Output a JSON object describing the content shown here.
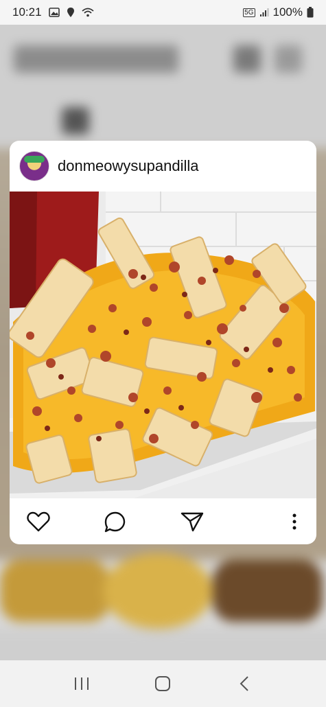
{
  "status_bar": {
    "time": "10:21",
    "network": "5G",
    "battery": "100%",
    "icons": [
      "gallery-icon",
      "location-icon",
      "wifi-icon",
      "signal-icon",
      "battery-icon"
    ]
  },
  "post": {
    "username": "donmeowysupandilla",
    "image_alt": "cheese bacon fries",
    "actions": [
      "like-icon",
      "comment-icon",
      "share-icon",
      "more-icon"
    ]
  },
  "nav_bar": {
    "items": [
      "recent-apps-icon",
      "home-icon",
      "back-icon"
    ]
  },
  "colors": {
    "card": "#ffffff",
    "text": "#111111",
    "background": "#d9d9d9"
  }
}
